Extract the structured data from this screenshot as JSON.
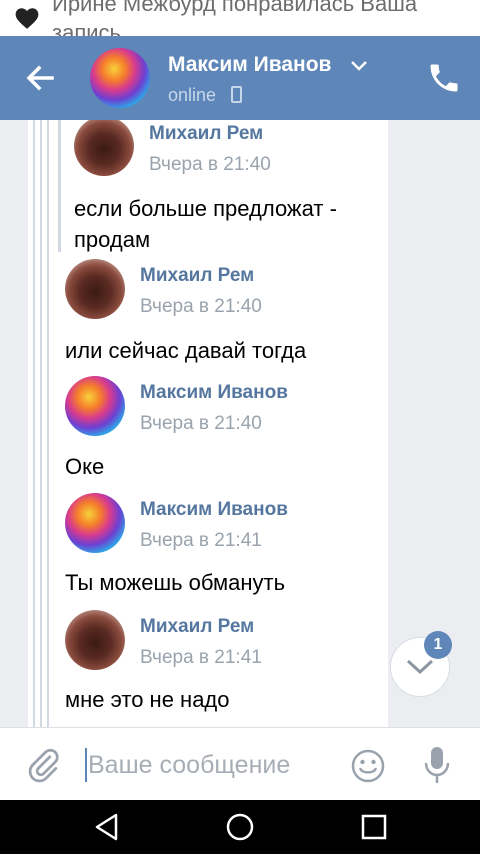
{
  "notification": {
    "line1": "Ирине Межбурд понравилась Ваша",
    "line2": "запись"
  },
  "header": {
    "name": "Максим Иванов",
    "status": "online"
  },
  "messages": [
    {
      "sender": "Михаил Рем",
      "time": "Вчера в 21:40",
      "text": "если больше предложат - продам",
      "avatar": "mikhail-avatar"
    },
    {
      "sender": "Михаил Рем",
      "time": "Вчера в 21:40",
      "text": "или сейчас давай тогда",
      "avatar": "mikhail-avatar"
    },
    {
      "sender": "Максим Иванов",
      "time": "Вчера в 21:40",
      "text": "Оке",
      "avatar": "maksim-avatar"
    },
    {
      "sender": "Максим Иванов",
      "time": "Вчера в 21:41",
      "text": "Ты можешь обмануть",
      "avatar": "maksim-avatar"
    },
    {
      "sender": "Михаил Рем",
      "time": "Вчера в 21:41",
      "text": "мне это не надо",
      "avatar": "mikhail-avatar"
    }
  ],
  "scroll_badge": "1",
  "composer": {
    "placeholder": "Ваше сообщение",
    "value": ""
  },
  "colors": {
    "header": "#5e86b8",
    "name_link": "#55779f",
    "chat_bg": "#ebedf0"
  }
}
